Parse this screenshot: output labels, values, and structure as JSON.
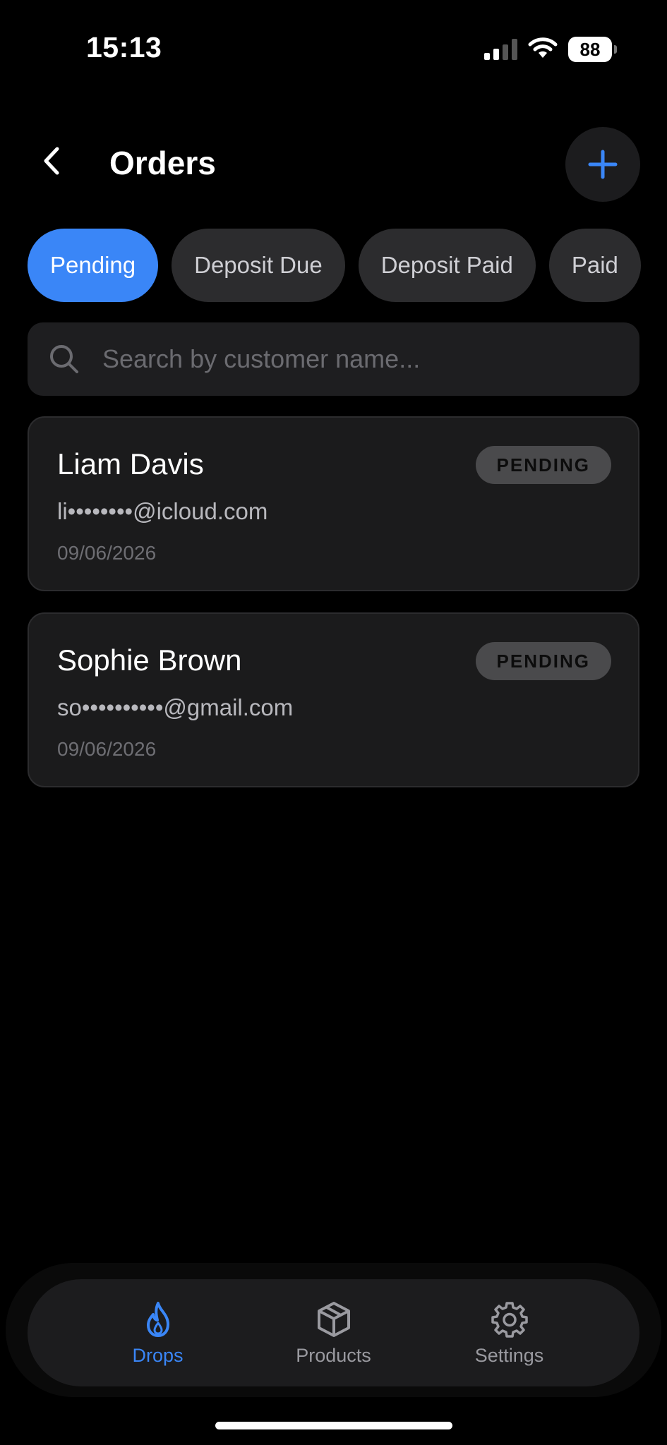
{
  "status_bar": {
    "time": "15:13",
    "battery": "88"
  },
  "header": {
    "title": "Orders"
  },
  "tabs": [
    {
      "label": "Pending",
      "active": true
    },
    {
      "label": "Deposit Due",
      "active": false
    },
    {
      "label": "Deposit Paid",
      "active": false
    },
    {
      "label": "Paid",
      "active": false
    }
  ],
  "search": {
    "placeholder": "Search by customer name..."
  },
  "orders": [
    {
      "name": "Liam Davis",
      "email": "li••••••••@icloud.com",
      "date": "09/06/2026",
      "status": "PENDING"
    },
    {
      "name": "Sophie Brown",
      "email": "so••••••••••@gmail.com",
      "date": "09/06/2026",
      "status": "PENDING"
    }
  ],
  "bottom_nav": [
    {
      "label": "Drops",
      "icon": "flame-icon",
      "active": true
    },
    {
      "label": "Products",
      "icon": "box-icon",
      "active": false
    },
    {
      "label": "Settings",
      "icon": "gear-icon",
      "active": false
    }
  ],
  "colors": {
    "accent": "#3a86f7",
    "background": "#000000",
    "card": "#1b1b1c"
  }
}
